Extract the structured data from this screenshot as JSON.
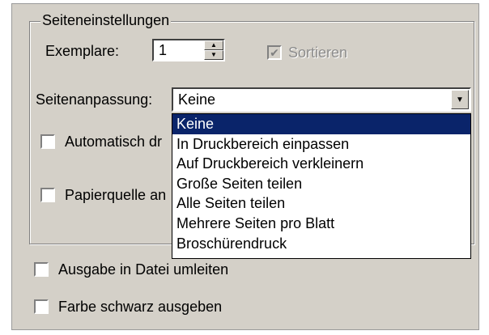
{
  "group_title": "Seiteneinstellungen",
  "copies": {
    "label": "Exemplare:",
    "value": "1"
  },
  "collate": {
    "label": "Sortieren",
    "checked": true,
    "enabled": false
  },
  "page_scaling": {
    "label": "Seitenanpassung:",
    "selected": "Keine",
    "options": [
      "Keine",
      "In Druckbereich einpassen",
      "Auf Druckbereich verkleinern",
      "Große Seiten teilen",
      "Alle Seiten teilen",
      "Mehrere Seiten pro Blatt",
      "Broschürendruck"
    ]
  },
  "auto_rotate": {
    "label_visible": "Automatisch dr",
    "checked": false
  },
  "paper_source": {
    "label_visible": "Papierquelle an",
    "checked": false
  },
  "print_to_file": {
    "label": "Ausgabe in Datei umleiten",
    "checked": false
  },
  "print_black": {
    "label": "Farbe schwarz ausgeben",
    "checked": false
  },
  "colors": {
    "dialog_bg": "#d4d0c8",
    "selection": "#0a246a"
  }
}
